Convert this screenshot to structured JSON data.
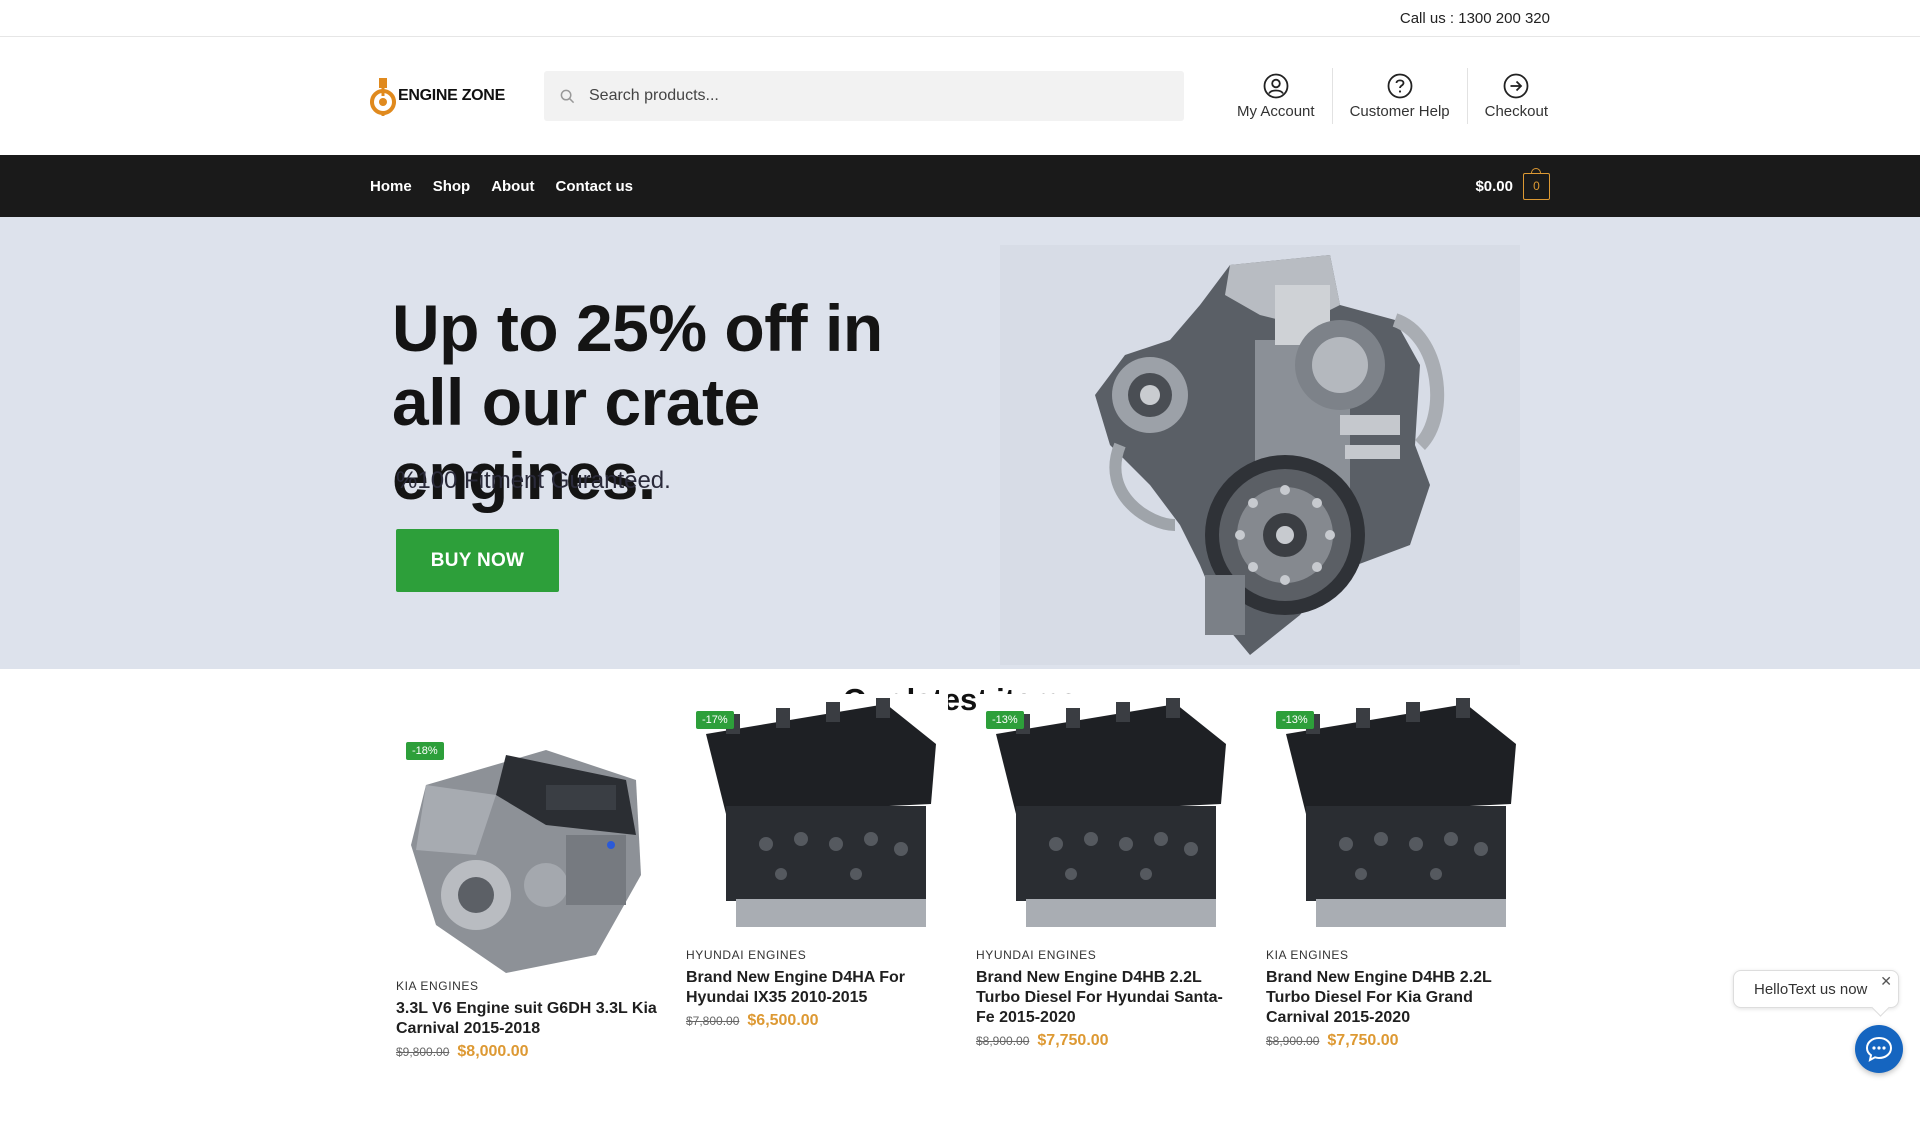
{
  "topbar": {
    "call": "Call us : 1300 200 320"
  },
  "header": {
    "logo_text": "ENGINE ZONE",
    "search_placeholder": "Search products...",
    "links": [
      {
        "label": "My Account",
        "icon": "user-circle-icon"
      },
      {
        "label": "Customer Help",
        "icon": "help-circle-icon"
      },
      {
        "label": "Checkout",
        "icon": "arrow-circle-icon"
      }
    ]
  },
  "nav": {
    "items": [
      "Home",
      "Shop",
      "About",
      "Contact us"
    ],
    "cart_total": "$0.00",
    "cart_count": "0"
  },
  "hero": {
    "headline": "Up to 25% off in all our crate engines.",
    "subtitle": "%100 Fitment Guranteed.",
    "button": "BUY NOW"
  },
  "latest": {
    "title": "Our latest items",
    "products": [
      {
        "badge": "-18%",
        "category": "KIA ENGINES",
        "name": "3.3L V6 Engine suit G6DH 3.3L Kia Carnival 2015-2018",
        "old_price": "$9,800.00",
        "price": "$8,000.00"
      },
      {
        "badge": "-17%",
        "category": "HYUNDAI ENGINES",
        "name": "Brand New Engine D4HA For Hyundai IX35 2010-2015",
        "old_price": "$7,800.00",
        "price": "$6,500.00"
      },
      {
        "badge": "-13%",
        "category": "HYUNDAI ENGINES",
        "name": "Brand New Engine D4HB 2.2L Turbo Diesel For Hyundai Santa-Fe 2015-2020",
        "old_price": "$8,900.00",
        "price": "$7,750.00"
      },
      {
        "badge": "-13%",
        "category": "KIA ENGINES",
        "name": "Brand New Engine D4HB 2.2L Turbo Diesel For Kia Grand Carnival 2015-2020",
        "old_price": "$8,900.00",
        "price": "$7,750.00"
      }
    ]
  },
  "chat": {
    "text": "HelloText us now",
    "close": "✕"
  },
  "colors": {
    "accent_green": "#2d9f3a",
    "price_orange": "#dd9933",
    "nav_bg": "#1a1a1a",
    "hero_bg": "#dde2ec",
    "chat_blue": "#1565c0"
  }
}
